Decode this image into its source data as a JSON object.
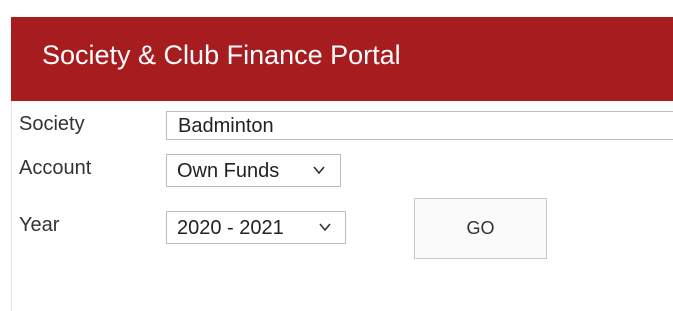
{
  "header": {
    "title": "Society & Club Finance Portal"
  },
  "form": {
    "society": {
      "label": "Society",
      "value": "Badminton"
    },
    "account": {
      "label": "Account",
      "value": "Own Funds"
    },
    "year": {
      "label": "Year",
      "value": "2020 - 2021"
    },
    "go_label": "GO"
  },
  "colors": {
    "header_bg": "#a61c1f",
    "header_text": "#ffffff"
  },
  "icons": {
    "dropdown": "chevron-down-icon"
  }
}
